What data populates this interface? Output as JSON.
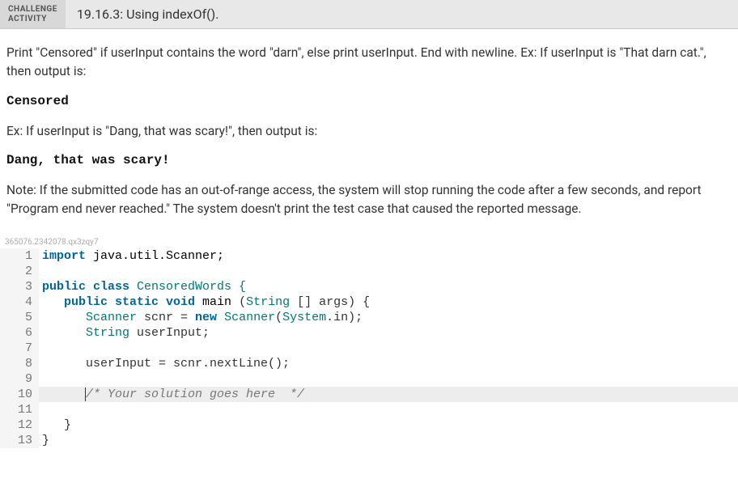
{
  "header": {
    "tag_line1": "CHALLENGE",
    "tag_line2": "ACTIVITY",
    "title": "19.16.3: Using indexOf()."
  },
  "prompt": {
    "p1": "Print \"Censored\" if userInput contains the word \"darn\", else print userInput. End with newline. Ex: If userInput is \"That darn cat.\", then output is:",
    "out1": "Censored",
    "p2": "Ex: If userInput is \"Dang, that was scary!\", then output is:",
    "out2": "Dang, that was scary!",
    "p3": "Note: If the submitted code has an out-of-range access, the system will stop running the code after a few seconds, and report \"Program end never reached.\" The system doesn't print the test case that caused the reported message."
  },
  "watermark": "365076.2342078.qx3zqy7",
  "code": {
    "tokens": [
      [
        {
          "t": "import ",
          "c": "kw"
        },
        {
          "t": "java.util.Scanner;",
          "c": "ns"
        }
      ],
      [],
      [
        {
          "t": "public class ",
          "c": "kw"
        },
        {
          "t": "CensoredWords {",
          "c": "type"
        }
      ],
      [
        {
          "t": "   ",
          "c": ""
        },
        {
          "t": "public static void ",
          "c": "kw"
        },
        {
          "t": "main ",
          "c": "func"
        },
        {
          "t": "(",
          "c": ""
        },
        {
          "t": "String",
          "c": "type"
        },
        {
          "t": " [] args) {",
          "c": ""
        }
      ],
      [
        {
          "t": "      ",
          "c": ""
        },
        {
          "t": "Scanner",
          "c": "type"
        },
        {
          "t": " scnr = ",
          "c": ""
        },
        {
          "t": "new ",
          "c": "kw"
        },
        {
          "t": "Scanner",
          "c": "type"
        },
        {
          "t": "(",
          "c": ""
        },
        {
          "t": "System",
          "c": "type"
        },
        {
          "t": ".in);",
          "c": ""
        }
      ],
      [
        {
          "t": "      ",
          "c": ""
        },
        {
          "t": "String",
          "c": "type"
        },
        {
          "t": " userInput;",
          "c": ""
        }
      ],
      [],
      [
        {
          "t": "      userInput = scnr.nextLine();",
          "c": ""
        }
      ],
      [],
      [
        {
          "t": "      ",
          "c": ""
        },
        {
          "t": "/* Your solution goes here  */",
          "c": "comment"
        }
      ],
      [],
      [
        {
          "t": "   }  ",
          "c": ""
        }
      ],
      [
        {
          "t": "}",
          "c": ""
        }
      ]
    ],
    "highlight_line": 10,
    "cursor_line": 10
  }
}
